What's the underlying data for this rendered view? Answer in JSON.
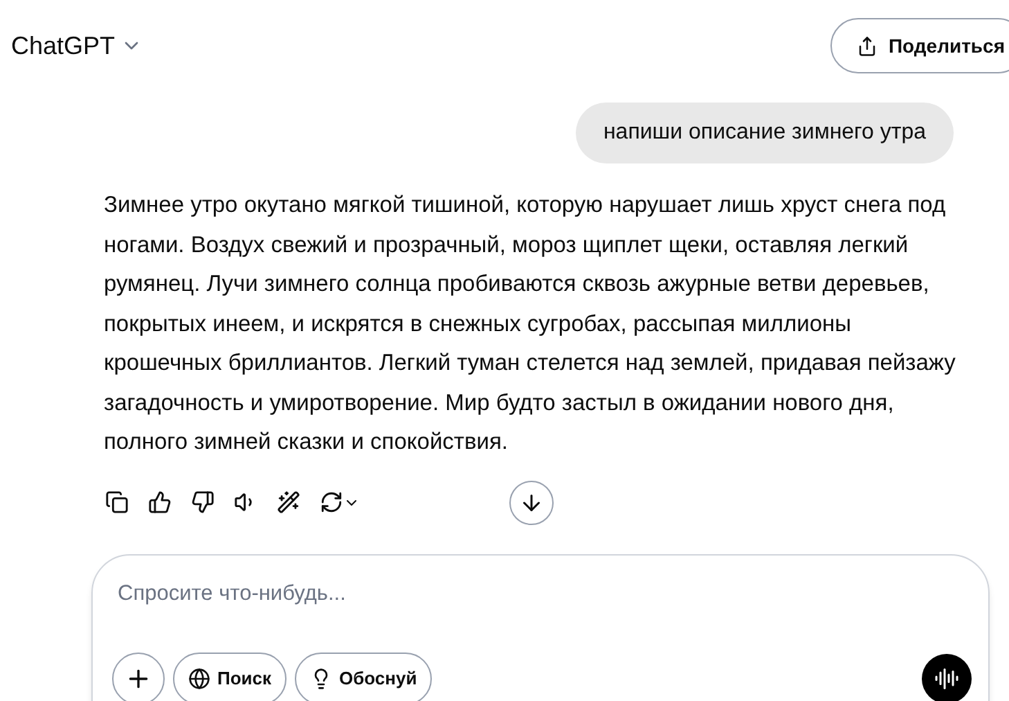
{
  "header": {
    "title": "ChatGPT",
    "share_button": "Поделиться"
  },
  "user_message": "напиши описание зимнего утра",
  "assistant_message": "Зимнее утро окутано мягкой тишиной, которую нарушает лишь хруст снега под ногами. Воздух свежий и прозрачный, мороз щиплет щеки, оставляя легкий румянец. Лучи зимнего солнца пробиваются сквозь ажурные ветви деревьев, покрытых инеем, и искрятся в снежных сугробах, рассыпая миллионы крошечных бриллиантов. Легкий туман стелется над землей, придавая пейзажу загадочность и умиротворение. Мир будто застыл в ожидании нового дня, полного зимней сказки и спокойствия.",
  "composer": {
    "placeholder": "Спросите что-нибудь...",
    "tools": [
      "Поиск",
      "Обоснуй"
    ]
  }
}
